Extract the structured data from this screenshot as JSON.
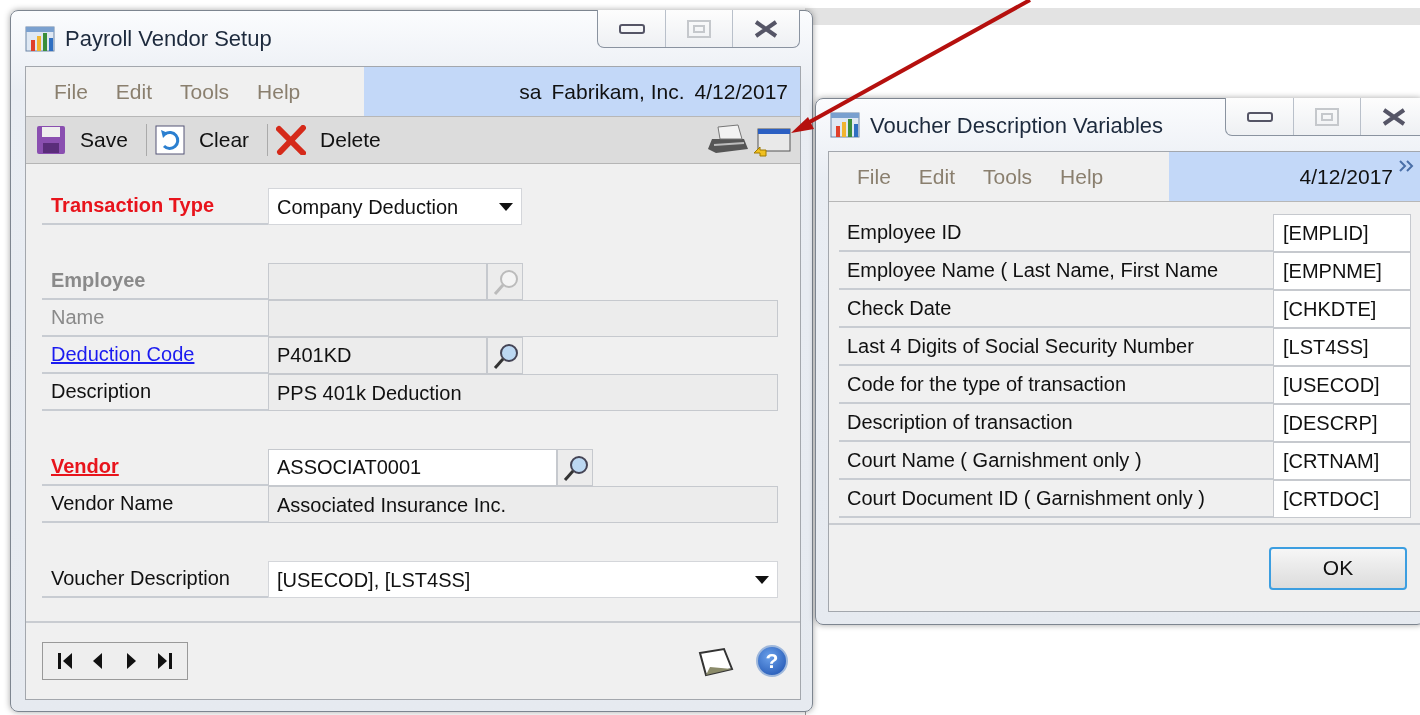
{
  "main_window": {
    "title": "Payroll Vendor Setup",
    "window_buttons": [
      {
        "kind": "minimize",
        "disabled": false
      },
      {
        "kind": "maximize",
        "disabled": true
      },
      {
        "kind": "close",
        "disabled": false
      }
    ],
    "menu": [
      "File",
      "Edit",
      "Tools",
      "Help"
    ],
    "user": "sa",
    "company": "Fabrikam, Inc.",
    "date": "4/12/2017",
    "toolbar": [
      {
        "kind": "save",
        "label": "Save"
      },
      {
        "kind": "clear",
        "label": "Clear"
      },
      {
        "kind": "delete",
        "label": "Delete"
      }
    ],
    "sections": [
      [
        {
          "label": "Transaction Type",
          "required": true,
          "link": false,
          "bold": true,
          "kind": "dropdown",
          "value": "Company Deduction",
          "disabled": false
        }
      ],
      [
        {
          "label": "Employee",
          "required": false,
          "link": false,
          "bold": true,
          "kind": "lookup",
          "disabled": true
        },
        {
          "label": "Name",
          "required": false,
          "link": false,
          "bold": false,
          "kind": "display",
          "disabled": true
        },
        {
          "label": "Deduction Code",
          "required": false,
          "link": true,
          "bold": false,
          "kind": "lookup",
          "value": "P401KD",
          "disabled": false
        },
        {
          "label": "Description",
          "required": false,
          "link": false,
          "bold": false,
          "kind": "display",
          "value": "PPS 401k Deduction",
          "disabled": false
        }
      ],
      [
        {
          "label": "Vendor",
          "required": true,
          "link": true,
          "bold": true,
          "kind": "wide_lookup",
          "value": "ASSOCIAT0001",
          "disabled": false
        },
        {
          "label": "Vendor Name",
          "required": false,
          "link": false,
          "bold": false,
          "kind": "display",
          "value": "Associated Insurance Inc.",
          "disabled": false
        }
      ],
      [
        {
          "label": "Voucher Description",
          "required": false,
          "link": false,
          "bold": false,
          "kind": "wide_dropdown",
          "value": "[USECOD], [LST4SS]",
          "disabled": false
        }
      ]
    ],
    "help_glyph": "?"
  },
  "variables_window": {
    "title": "Voucher Description Variables",
    "window_buttons": [
      {
        "kind": "minimize",
        "disabled": false
      },
      {
        "kind": "maximize",
        "disabled": true
      },
      {
        "kind": "close",
        "disabled": false
      }
    ],
    "menu": [
      "File",
      "Edit",
      "Tools",
      "Help"
    ],
    "date": "4/12/2017",
    "rows": [
      {
        "name": "Employee ID",
        "code": "[EMPLID]"
      },
      {
        "name": "Employee Name ( Last Name, First Name",
        "code": "[EMPNME]"
      },
      {
        "name": "Check Date",
        "code": "[CHKDTE]"
      },
      {
        "name": "Last 4 Digits of Social Security Number",
        "code": "[LST4SS]"
      },
      {
        "name": "Code for the type of transaction",
        "code": "[USECOD]"
      },
      {
        "name": "Description of transaction",
        "code": "[DESCRP]"
      },
      {
        "name": "Court Name ( Garnishment only )",
        "code": "[CRTNAM]"
      },
      {
        "name": "Court Document ID ( Garnishment only )",
        "code": "[CRTDOC]"
      }
    ],
    "ok_button": "OK"
  }
}
